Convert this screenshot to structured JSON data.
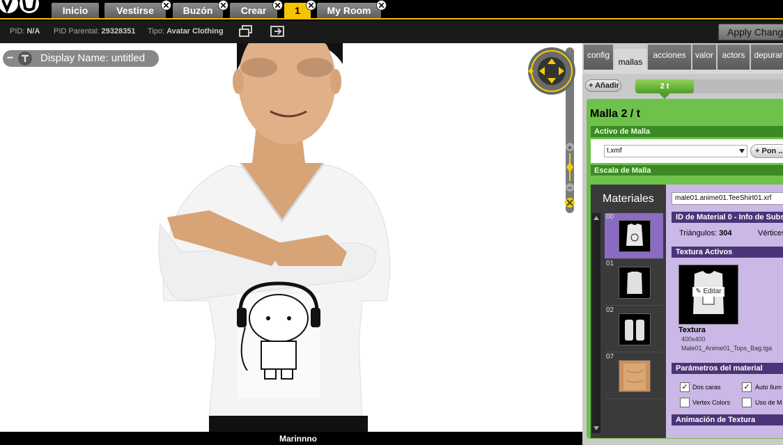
{
  "nav": {
    "tabs": [
      {
        "label": "Inicio"
      },
      {
        "label": "Vestirse",
        "closable": true
      },
      {
        "label": "Buzón",
        "closable": true
      },
      {
        "label": "Crear",
        "closable": true
      },
      {
        "label": "1",
        "closable": true,
        "active": true
      },
      {
        "label": "My Room",
        "closable": true
      }
    ],
    "close_glyph": "✕"
  },
  "info": {
    "pid_label": "PID:",
    "pid_value": "N/A",
    "parent_label": "PID Parental:",
    "parent_value": "29328351",
    "type_label": "Tipo:",
    "type_value": "Avatar Clothing",
    "apply_label": "Apply Changes"
  },
  "viewport": {
    "display_name": "Display Name: untitled",
    "minus": "−",
    "username": "Marinnno"
  },
  "panel": {
    "tabs": [
      "config",
      "mallas",
      "acciones",
      "valor",
      "actors",
      "depurar"
    ],
    "active_tab": "mallas",
    "add_label": "Añadir",
    "mesh_chip": "2 t",
    "mesh_title": "Malla 2 / t",
    "active_mesh_label": "Activo de Malla",
    "mesh_file": "t.xmf",
    "pon_label": "Pon ...",
    "scale_label": "Escala de Malla",
    "materials_title": "Materiales",
    "thumbs": [
      {
        "idx": "00",
        "selected": true
      },
      {
        "idx": "01"
      },
      {
        "idx": "02"
      },
      {
        "idx": "07"
      }
    ],
    "material_file": "male01.anime01.TeeShirt01.xrf",
    "material_id_header": "ID de Material 0 - Info de Subs",
    "triangles_label": "Triángulos:",
    "triangles_value": "304",
    "vertices_label": "Vértices",
    "texture_assets_header": "Textura Activos",
    "edit_label": "Editar",
    "texture_title": "Textura",
    "texture_size": "400x400",
    "texture_name": "Male01_Anime01_Tops_Bag.tga",
    "params_header": "Parámetros del material",
    "checks": [
      {
        "label": "Dos caras",
        "checked": true
      },
      {
        "label": "Auto Ilum",
        "checked": true
      },
      {
        "label": "Vertex Colors",
        "checked": false
      },
      {
        "label": "Uso de M",
        "checked": false
      }
    ],
    "anim_header": "Animación de Textura",
    "check_glyph": "✓"
  },
  "colors": {
    "accent": "#f5c400",
    "panel_green": "#6ec14a",
    "dark_green": "#3a8b26",
    "purple": "#4b3578",
    "lilac": "#cbb8e6"
  }
}
